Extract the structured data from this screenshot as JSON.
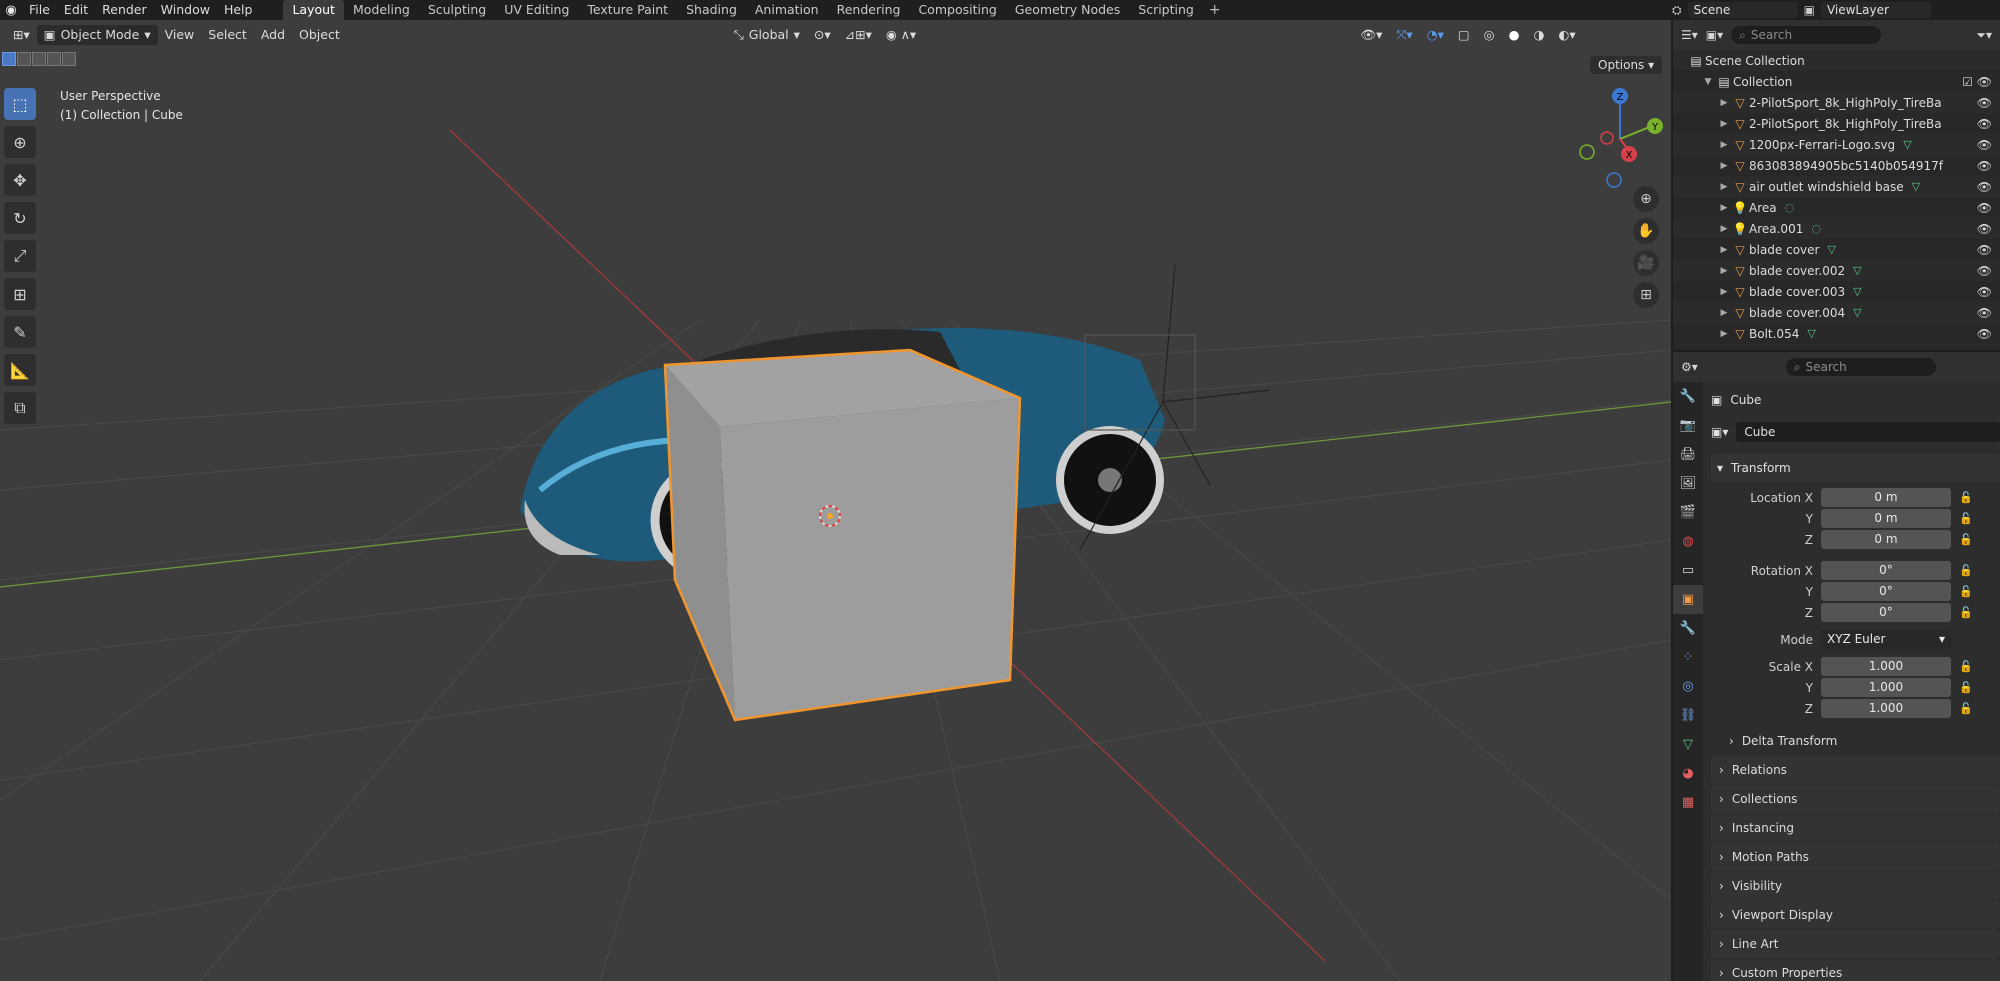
{
  "menu": {
    "items": [
      "File",
      "Edit",
      "Render",
      "Window",
      "Help"
    ],
    "workspaces": [
      "Layout",
      "Modeling",
      "Sculpting",
      "UV Editing",
      "Texture Paint",
      "Shading",
      "Animation",
      "Rendering",
      "Compositing",
      "Geometry Nodes",
      "Scripting"
    ],
    "active_workspace": "Layout",
    "scene": "Scene",
    "view_layer": "ViewLayer"
  },
  "viewport": {
    "mode": "Object Mode",
    "menus": [
      "View",
      "Select",
      "Add",
      "Object"
    ],
    "transform_orientation": "Global",
    "options": "Options",
    "perspective_label": "User Perspective",
    "collection_label": "(1) Collection | Cube",
    "gizmo_axes": [
      "Z",
      "Y",
      "X"
    ]
  },
  "outliner": {
    "search_placeholder": "Search",
    "scene_collection": "Scene Collection",
    "collection": "Collection",
    "items": [
      {
        "name": "2-PilotSport_8k_HighPoly_TireBa",
        "icon": "mesh-icon"
      },
      {
        "name": "2-PilotSport_8k_HighPoly_TireBa",
        "icon": "mesh-icon"
      },
      {
        "name": "1200px-Ferrari-Logo.svg",
        "icon": "mesh-icon"
      },
      {
        "name": "863083894905bc5140b054917f",
        "icon": "mesh-icon"
      },
      {
        "name": "air outlet windshield base",
        "icon": "mesh-icon"
      },
      {
        "name": "Area",
        "icon": "light-icon"
      },
      {
        "name": "Area.001",
        "icon": "light-icon"
      },
      {
        "name": "blade cover",
        "icon": "mesh-icon"
      },
      {
        "name": "blade cover.002",
        "icon": "mesh-icon"
      },
      {
        "name": "blade cover.003",
        "icon": "mesh-icon"
      },
      {
        "name": "blade cover.004",
        "icon": "mesh-icon"
      },
      {
        "name": "Bolt.054",
        "icon": "mesh-icon"
      }
    ]
  },
  "properties": {
    "search_placeholder": "Search",
    "object_name": "Cube",
    "data_name": "Cube",
    "transform_title": "Transform",
    "location": {
      "label_x": "Location X",
      "x": "0 m",
      "y": "0 m",
      "z": "0 m"
    },
    "rotation": {
      "label_x": "Rotation X",
      "x": "0°",
      "y": "0°",
      "z": "0°"
    },
    "mode_label": "Mode",
    "mode_value": "XYZ Euler",
    "scale": {
      "label_x": "Scale X",
      "x": "1.000",
      "y": "1.000",
      "z": "1.000"
    },
    "axis_y": "Y",
    "axis_z": "Z",
    "delta": "Delta Transform",
    "panels": [
      "Relations",
      "Collections",
      "Instancing",
      "Motion Paths",
      "Visibility",
      "Viewport Display",
      "Line Art",
      "Custom Properties"
    ]
  }
}
